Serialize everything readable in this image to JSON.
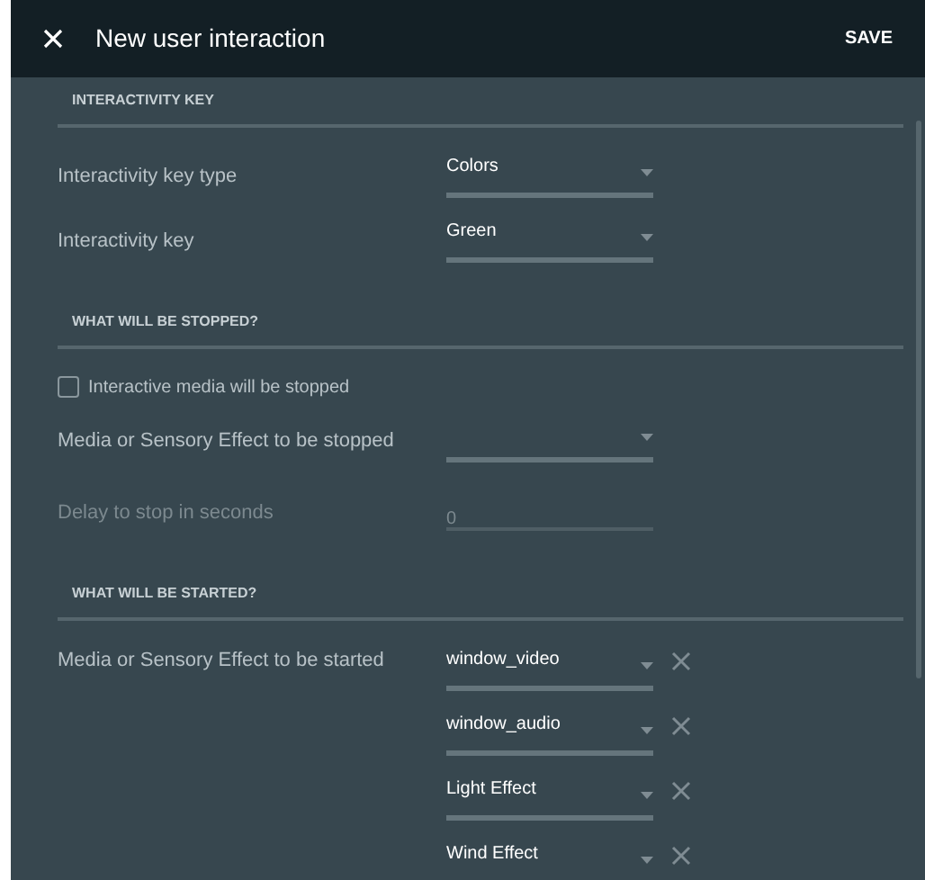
{
  "header": {
    "title": "New user interaction",
    "action": "SAVE"
  },
  "sections": [
    {
      "title": "INTERACTIVITY KEY",
      "rows": [
        {
          "kind": "select",
          "label": "Interactivity key type",
          "value": "Colors",
          "disabled": false
        },
        {
          "kind": "select",
          "label": "Interactivity key",
          "value": "Green",
          "disabled": false
        }
      ]
    },
    {
      "title": "WHAT WILL BE STOPPED?",
      "rows": [
        {
          "kind": "checkbox",
          "label": "Interactive media will be stopped",
          "checked": false
        },
        {
          "kind": "select",
          "label": "Media or Sensory Effect to be stopped",
          "disabled": false
        },
        {
          "kind": "input",
          "label": "Delay to stop in seconds",
          "value": "0",
          "disabled": true
        }
      ]
    },
    {
      "title": "WHAT WILL BE STARTED?",
      "rows": [
        {
          "kind": "multiselect",
          "label": "Media or Sensory Effect to be started",
          "values": [
            "window_video",
            "window_audio",
            "Light Effect",
            "Wind Effect"
          ]
        }
      ]
    }
  ]
}
